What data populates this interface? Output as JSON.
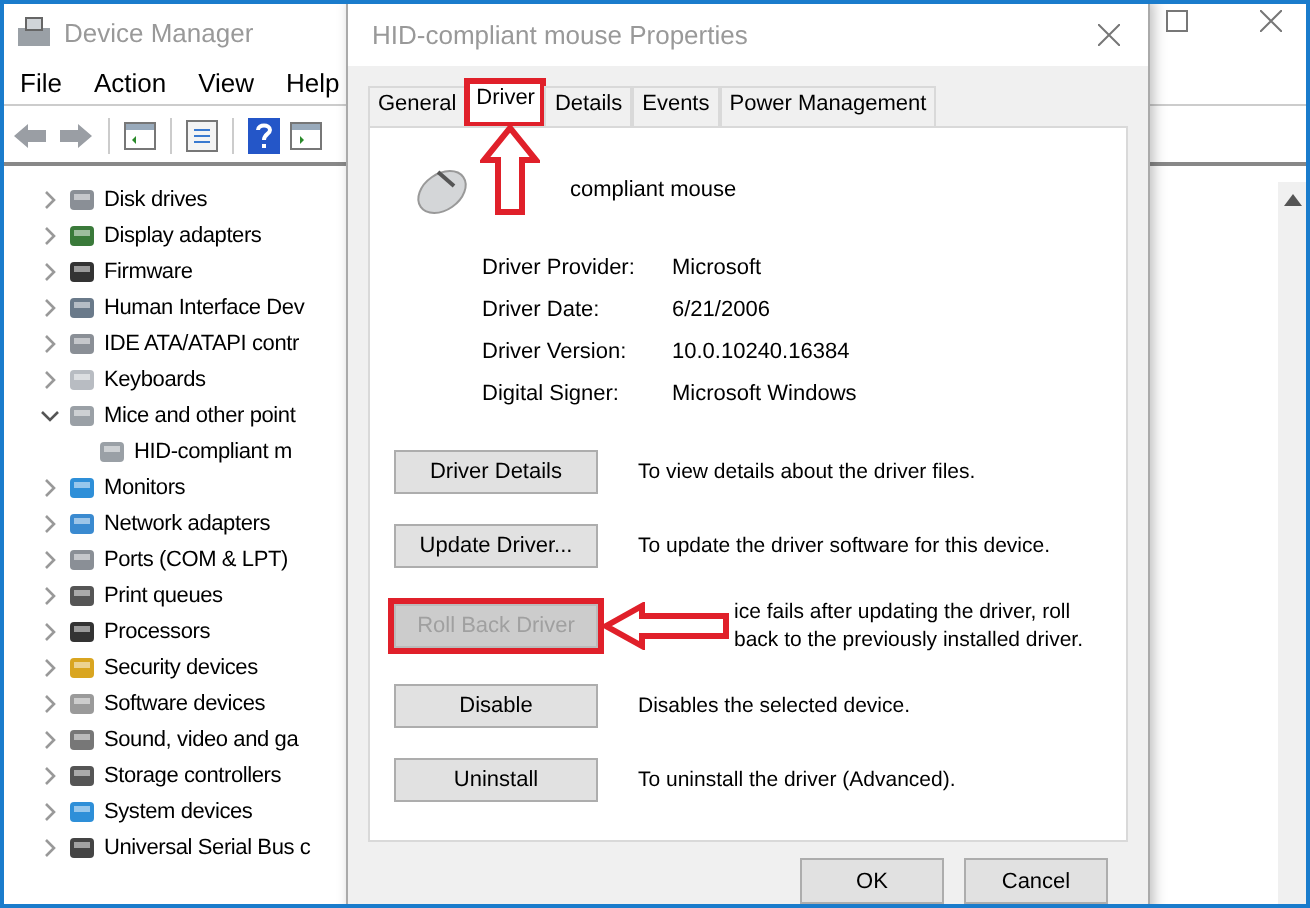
{
  "main_window": {
    "title": "Device Manager",
    "menu": [
      "File",
      "Action",
      "View",
      "Help"
    ],
    "tree": [
      {
        "label": "Disk drives",
        "kind": "disk",
        "expanded": false
      },
      {
        "label": "Display adapters",
        "kind": "card",
        "expanded": false
      },
      {
        "label": "Firmware",
        "kind": "chip",
        "expanded": false
      },
      {
        "label": "Human Interface Dev",
        "kind": "hid",
        "expanded": false
      },
      {
        "label": "IDE ATA/ATAPI contr",
        "kind": "disk",
        "expanded": false
      },
      {
        "label": "Keyboards",
        "kind": "keyboard",
        "expanded": false
      },
      {
        "label": "Mice and other point",
        "kind": "mouse",
        "expanded": true,
        "children": [
          {
            "label": "HID-compliant m",
            "kind": "mouse"
          }
        ]
      },
      {
        "label": "Monitors",
        "kind": "monitor",
        "expanded": false
      },
      {
        "label": "Network adapters",
        "kind": "network",
        "expanded": false
      },
      {
        "label": "Ports (COM & LPT)",
        "kind": "port",
        "expanded": false
      },
      {
        "label": "Print queues",
        "kind": "printer",
        "expanded": false
      },
      {
        "label": "Processors",
        "kind": "chip",
        "expanded": false
      },
      {
        "label": "Security devices",
        "kind": "key",
        "expanded": false
      },
      {
        "label": "Software devices",
        "kind": "software",
        "expanded": false
      },
      {
        "label": "Sound, video and ga",
        "kind": "speaker",
        "expanded": false
      },
      {
        "label": "Storage controllers",
        "kind": "storage",
        "expanded": false
      },
      {
        "label": "System devices",
        "kind": "monitor",
        "expanded": false
      },
      {
        "label": "Universal Serial Bus c",
        "kind": "usb",
        "expanded": false
      }
    ]
  },
  "dialog": {
    "title": "HID-compliant mouse Properties",
    "tabs": [
      {
        "label": "General",
        "selected": false,
        "highlighted": false
      },
      {
        "label": "Driver",
        "selected": true,
        "highlighted": true
      },
      {
        "label": "Details",
        "selected": false,
        "highlighted": false
      },
      {
        "label": "Events",
        "selected": false,
        "highlighted": false
      },
      {
        "label": "Power Management",
        "selected": false,
        "highlighted": false
      }
    ],
    "device_name": "compliant mouse",
    "properties": [
      {
        "label": "Driver Provider:",
        "value": "Microsoft"
      },
      {
        "label": "Driver Date:",
        "value": "6/21/2006"
      },
      {
        "label": "Driver Version:",
        "value": "10.0.10240.16384"
      },
      {
        "label": "Digital Signer:",
        "value": "Microsoft Windows"
      }
    ],
    "actions": [
      {
        "button": "Driver Details",
        "description": "To view details about the driver files.",
        "disabled": false,
        "highlighted": false
      },
      {
        "button": "Update Driver...",
        "description": "To update the driver software for this device.",
        "disabled": false,
        "highlighted": false
      },
      {
        "button": "Roll Back Driver",
        "description": "ice fails after updating the driver, roll back to the previously installed driver.",
        "disabled": true,
        "highlighted": true
      },
      {
        "button": "Disable",
        "description": "Disables the selected device.",
        "disabled": false,
        "highlighted": false
      },
      {
        "button": "Uninstall",
        "description": "To uninstall the driver (Advanced).",
        "disabled": false,
        "highlighted": false
      }
    ],
    "footer_buttons": [
      "OK",
      "Cancel"
    ]
  }
}
